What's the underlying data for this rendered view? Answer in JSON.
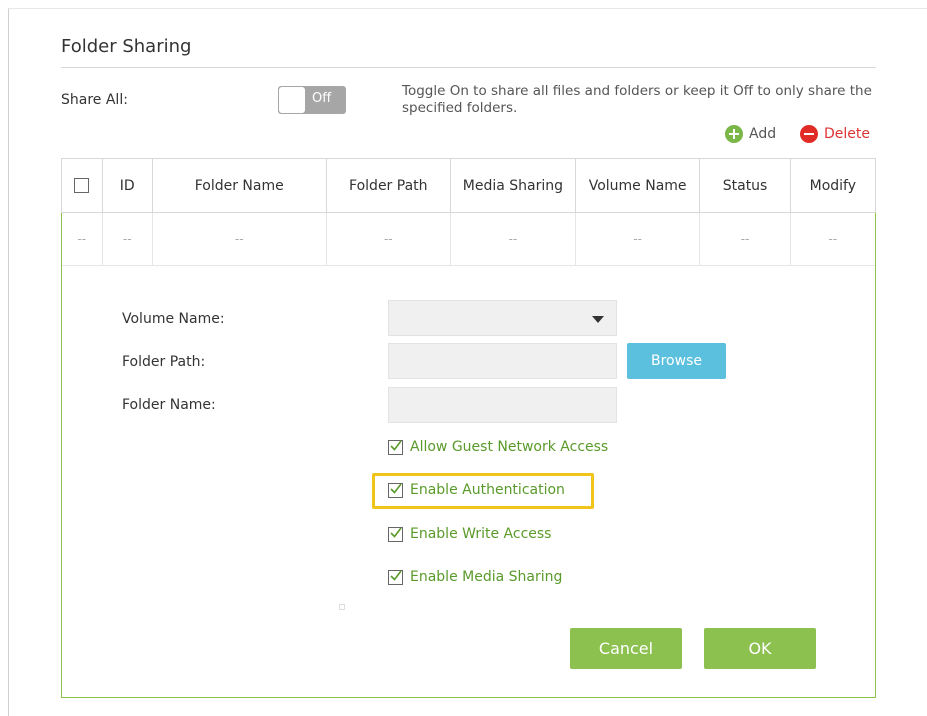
{
  "title": "Folder Sharing",
  "share_all": {
    "label": "Share All:",
    "toggle_state": "Off",
    "hint": "Toggle On to share all files and folders or keep it Off to only share the specified folders."
  },
  "actions": {
    "add": "Add",
    "delete": "Delete"
  },
  "table": {
    "columns": [
      "ID",
      "Folder Name",
      "Folder Path",
      "Media Sharing",
      "Volume Name",
      "Status",
      "Modify"
    ],
    "row": [
      "--",
      "--",
      "--",
      "--",
      "--",
      "--",
      "--",
      "--"
    ]
  },
  "form": {
    "volume_name_label": "Volume Name:",
    "volume_name_value": "",
    "folder_path_label": "Folder Path:",
    "folder_path_value": "",
    "folder_name_label": "Folder Name:",
    "folder_name_value": "",
    "browse": "Browse",
    "checkboxes": [
      {
        "label": "Allow Guest Network Access",
        "checked": true
      },
      {
        "label": "Enable Authentication",
        "checked": true
      },
      {
        "label": "Enable Write Access",
        "checked": true
      },
      {
        "label": "Enable Media Sharing",
        "checked": true
      }
    ],
    "cancel": "Cancel",
    "ok": "OK"
  },
  "colors": {
    "accent_green": "#8cc04f",
    "browse_blue": "#5bc0de",
    "delete_red": "#e02b27",
    "highlight": "#f0c419"
  }
}
